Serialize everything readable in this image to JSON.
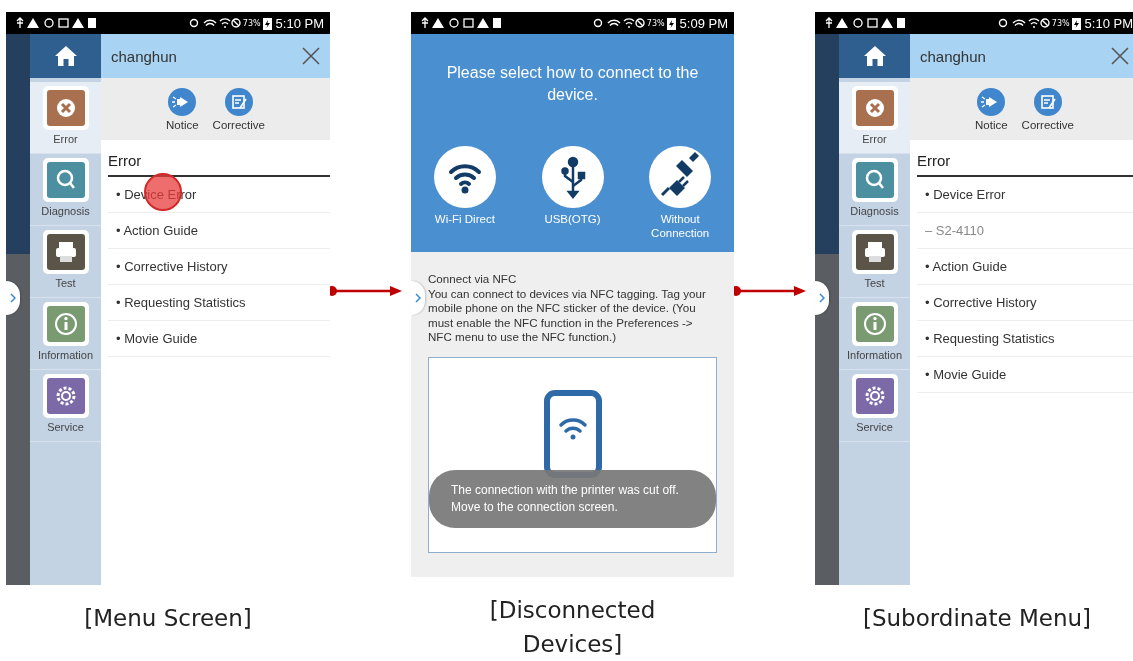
{
  "screens": [
    {
      "kind": "menu",
      "caption": "[Menu Screen]",
      "status_bar": {
        "battery": "73%",
        "time": "5:10 PM"
      },
      "header": {
        "user": "changhun"
      },
      "sidebar": [
        {
          "kind": "error",
          "label": "Error",
          "selected": true
        },
        {
          "kind": "diagnosis",
          "label": "Diagnosis",
          "selected": false
        },
        {
          "kind": "test",
          "label": "Test",
          "selected": false
        },
        {
          "kind": "information",
          "label": "Information",
          "selected": false
        },
        {
          "kind": "service",
          "label": "Service",
          "selected": false
        }
      ],
      "actions": [
        {
          "kind": "notice",
          "label": "Notice"
        },
        {
          "kind": "corrective",
          "label": "Corrective"
        }
      ],
      "section": "Error",
      "items": [
        {
          "kind": "item",
          "label": "• Device Error",
          "touched": true
        },
        {
          "kind": "item",
          "label": "• Action Guide",
          "touched": false
        },
        {
          "kind": "item",
          "label": "• Corrective History",
          "touched": false
        },
        {
          "kind": "item",
          "label": "• Requesting Statistics",
          "touched": false
        },
        {
          "kind": "item",
          "label": "• Movie Guide",
          "touched": false
        }
      ]
    },
    {
      "kind": "connect",
      "caption": "[Disconnected Devices]",
      "status_bar": {
        "battery": "73%",
        "time": "5:09 PM"
      },
      "title": "Please select how to connect to the device.",
      "options": [
        {
          "kind": "wifi",
          "label": "Wi-Fi Direct"
        },
        {
          "kind": "usb",
          "label": "USB(OTG)"
        },
        {
          "kind": "plug",
          "label": "Without Connection"
        }
      ],
      "nfc_heading": "Connect via NFC",
      "nfc_text": "You can connect to devices via NFC tagging. Tag your mobile phone on the NFC sticker of the device. (You must enable the NFC function in the Preferences -> NFC menu to use the NFC function.)",
      "toast": "The connection with the printer was cut off. Move to the connection screen."
    },
    {
      "kind": "menu",
      "caption": "[Subordinate Menu]",
      "status_bar": {
        "battery": "73%",
        "time": "5:10 PM"
      },
      "header": {
        "user": "changhun"
      },
      "sidebar": [
        {
          "kind": "error",
          "label": "Error",
          "selected": true
        },
        {
          "kind": "diagnosis",
          "label": "Diagnosis",
          "selected": false
        },
        {
          "kind": "test",
          "label": "Test",
          "selected": false
        },
        {
          "kind": "information",
          "label": "Information",
          "selected": false
        },
        {
          "kind": "service",
          "label": "Service",
          "selected": false
        }
      ],
      "actions": [
        {
          "kind": "notice",
          "label": "Notice"
        },
        {
          "kind": "corrective",
          "label": "Corrective"
        }
      ],
      "section": "Error",
      "items": [
        {
          "kind": "item",
          "label": "• Device Error",
          "touched": false
        },
        {
          "kind": "sub",
          "label": "– S2-4110",
          "touched": false
        },
        {
          "kind": "item",
          "label": "• Action Guide",
          "touched": false
        },
        {
          "kind": "item",
          "label": "• Corrective History",
          "touched": false
        },
        {
          "kind": "item",
          "label": "• Requesting Statistics",
          "touched": false
        },
        {
          "kind": "item",
          "label": "• Movie Guide",
          "touched": false
        }
      ]
    }
  ]
}
